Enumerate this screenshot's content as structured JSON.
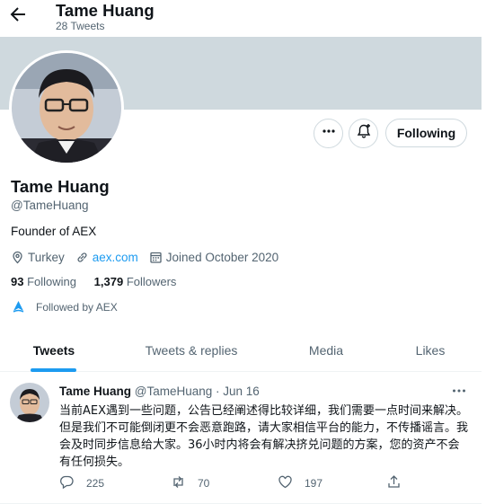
{
  "header": {
    "title": "Tame Huang",
    "subtitle": "28 Tweets"
  },
  "profile": {
    "name": "Tame Huang",
    "handle": "@TameHuang",
    "bio": "Founder of AEX",
    "location": "Turkey",
    "website": "aex.com",
    "joined": "Joined October 2020",
    "following_count": "93",
    "following_label": "Following",
    "followers_count": "1,379",
    "followers_label": "Followers",
    "followed_by": "Followed by AEX",
    "follow_button_label": "Following"
  },
  "tabs": [
    {
      "label": "Tweets",
      "active": true
    },
    {
      "label": "Tweets & replies",
      "active": false
    },
    {
      "label": "Media",
      "active": false
    },
    {
      "label": "Likes",
      "active": false
    }
  ],
  "tweet": {
    "author_name": "Tame Huang",
    "author_meta": "@TameHuang · Jun 16",
    "text": "当前AEX遇到一些问题，公告已经阐述得比较详细，我们需要一点时间来解决。但是我们不可能倒闭更不会恶意跑路，请大家相信平台的能力，不传播谣言。我会及时同步信息给大家。36小时内将会有解决挤兑问题的方案，您的资产不会有任何损失。",
    "replies": "225",
    "retweets": "70",
    "likes": "197"
  },
  "colors": {
    "accent": "#1d9bf0",
    "banner": "#cfd9de",
    "secondary_text": "#536471"
  },
  "icons": [
    "back-arrow-icon",
    "more-icon",
    "notification-bell-plus-icon",
    "location-icon",
    "link-icon",
    "calendar-icon",
    "reply-icon",
    "retweet-icon",
    "like-icon",
    "share-icon"
  ]
}
